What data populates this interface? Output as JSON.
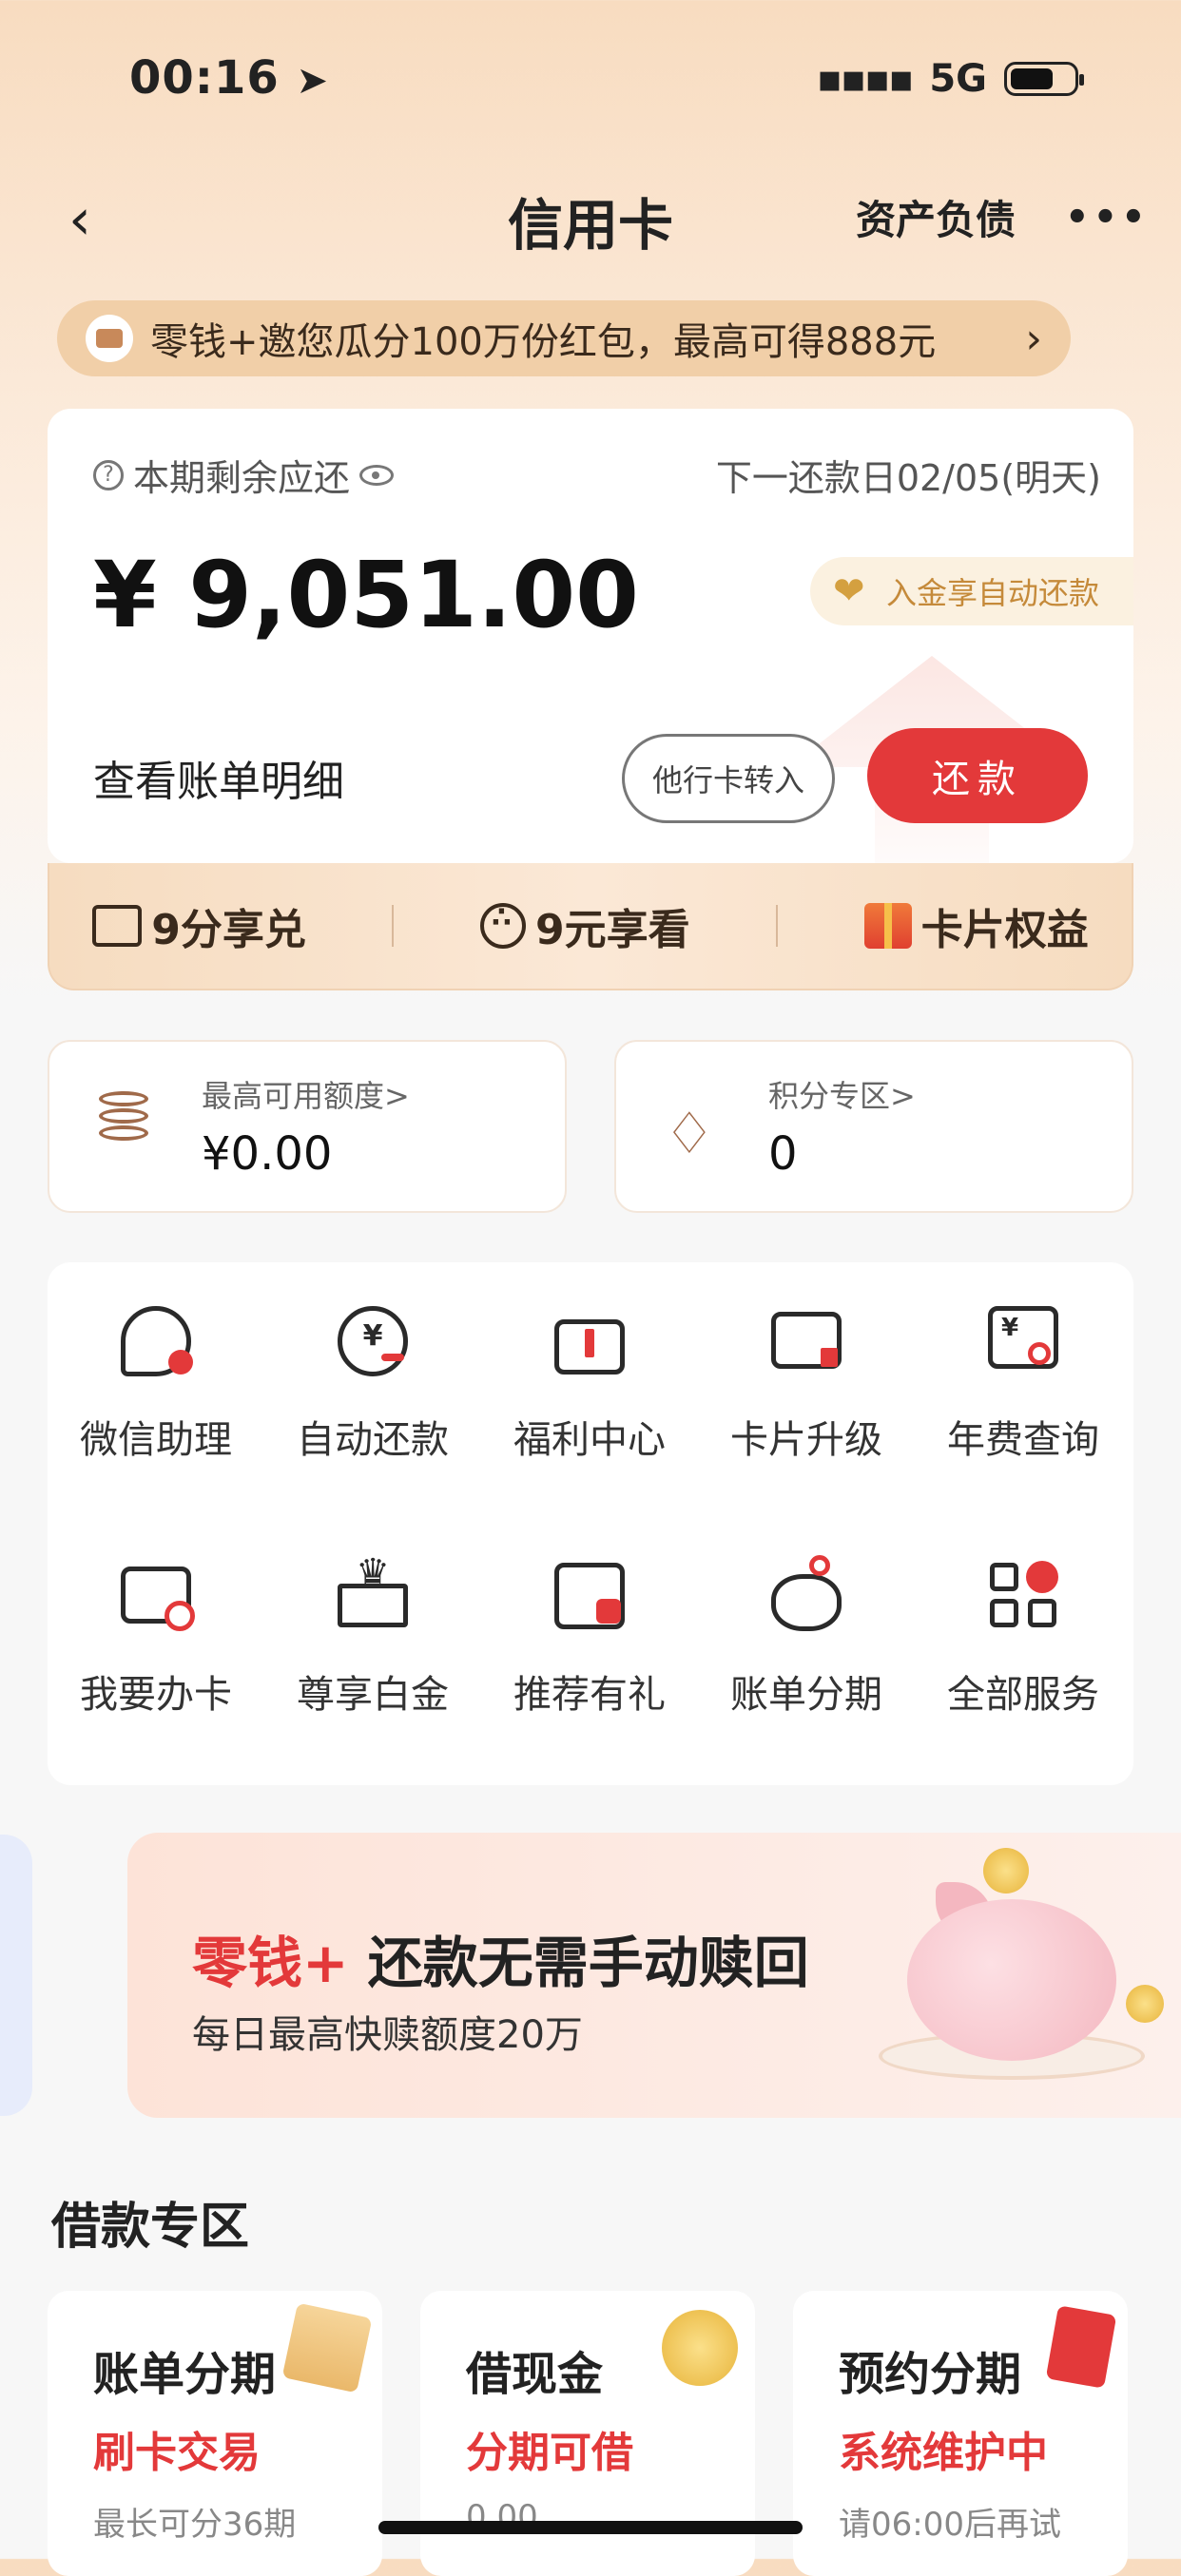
{
  "status_bar": {
    "time": "00:16",
    "network": "5G"
  },
  "nav": {
    "title": "信用卡",
    "assets_label": "资产负债"
  },
  "promo": {
    "text": "零钱+邀您瓜分100万份红包，最高可得888元"
  },
  "bill": {
    "due_label": "本期剩余应还",
    "next_date": "下一还款日02/05(明天)",
    "amount": "¥ 9,051.00",
    "auto_pay": "入金享自动还款",
    "detail": "查看账单明细",
    "transfer_button": "他行卡转入",
    "repay_button": "还款"
  },
  "rights": [
    {
      "label": "9分享兑"
    },
    {
      "label": "9元享看"
    },
    {
      "label": "卡片权益"
    }
  ],
  "limit": {
    "label": "最高可用额度>",
    "value": "¥0.00"
  },
  "points": {
    "label": "积分专区>",
    "value": "0"
  },
  "services": [
    {
      "label": "微信助理",
      "icon": "wechat-assistant-icon"
    },
    {
      "label": "自动还款",
      "icon": "auto-repay-icon"
    },
    {
      "label": "福利中心",
      "icon": "gift-icon"
    },
    {
      "label": "卡片升级",
      "icon": "card-upgrade-icon"
    },
    {
      "label": "年费查询",
      "icon": "annual-fee-icon"
    },
    {
      "label": "我要办卡",
      "icon": "apply-card-icon"
    },
    {
      "label": "尊享白金",
      "icon": "crown-icon"
    },
    {
      "label": "推荐有礼",
      "icon": "recommend-bag-icon"
    },
    {
      "label": "账单分期",
      "icon": "piggy-icon"
    },
    {
      "label": "全部服务",
      "icon": "all-services-icon"
    }
  ],
  "banner": {
    "title_red": "零钱+",
    "title_rest": " 还款无需手动赎回",
    "subtitle": "每日最高快赎额度20万"
  },
  "loan_section": {
    "title": "借款专区",
    "cards": [
      {
        "title": "账单分期",
        "highlight": "刷卡交易",
        "sub": "最长可分36期"
      },
      {
        "title": "借现金",
        "highlight": "分期可借",
        "sub": "0.00"
      },
      {
        "title": "预约分期",
        "highlight": "系统维护中",
        "sub": "请06:00后再试"
      }
    ]
  },
  "colors": {
    "accent": "#e3393a",
    "gold": "#c58a3a",
    "brown": "#3a2a1c"
  }
}
